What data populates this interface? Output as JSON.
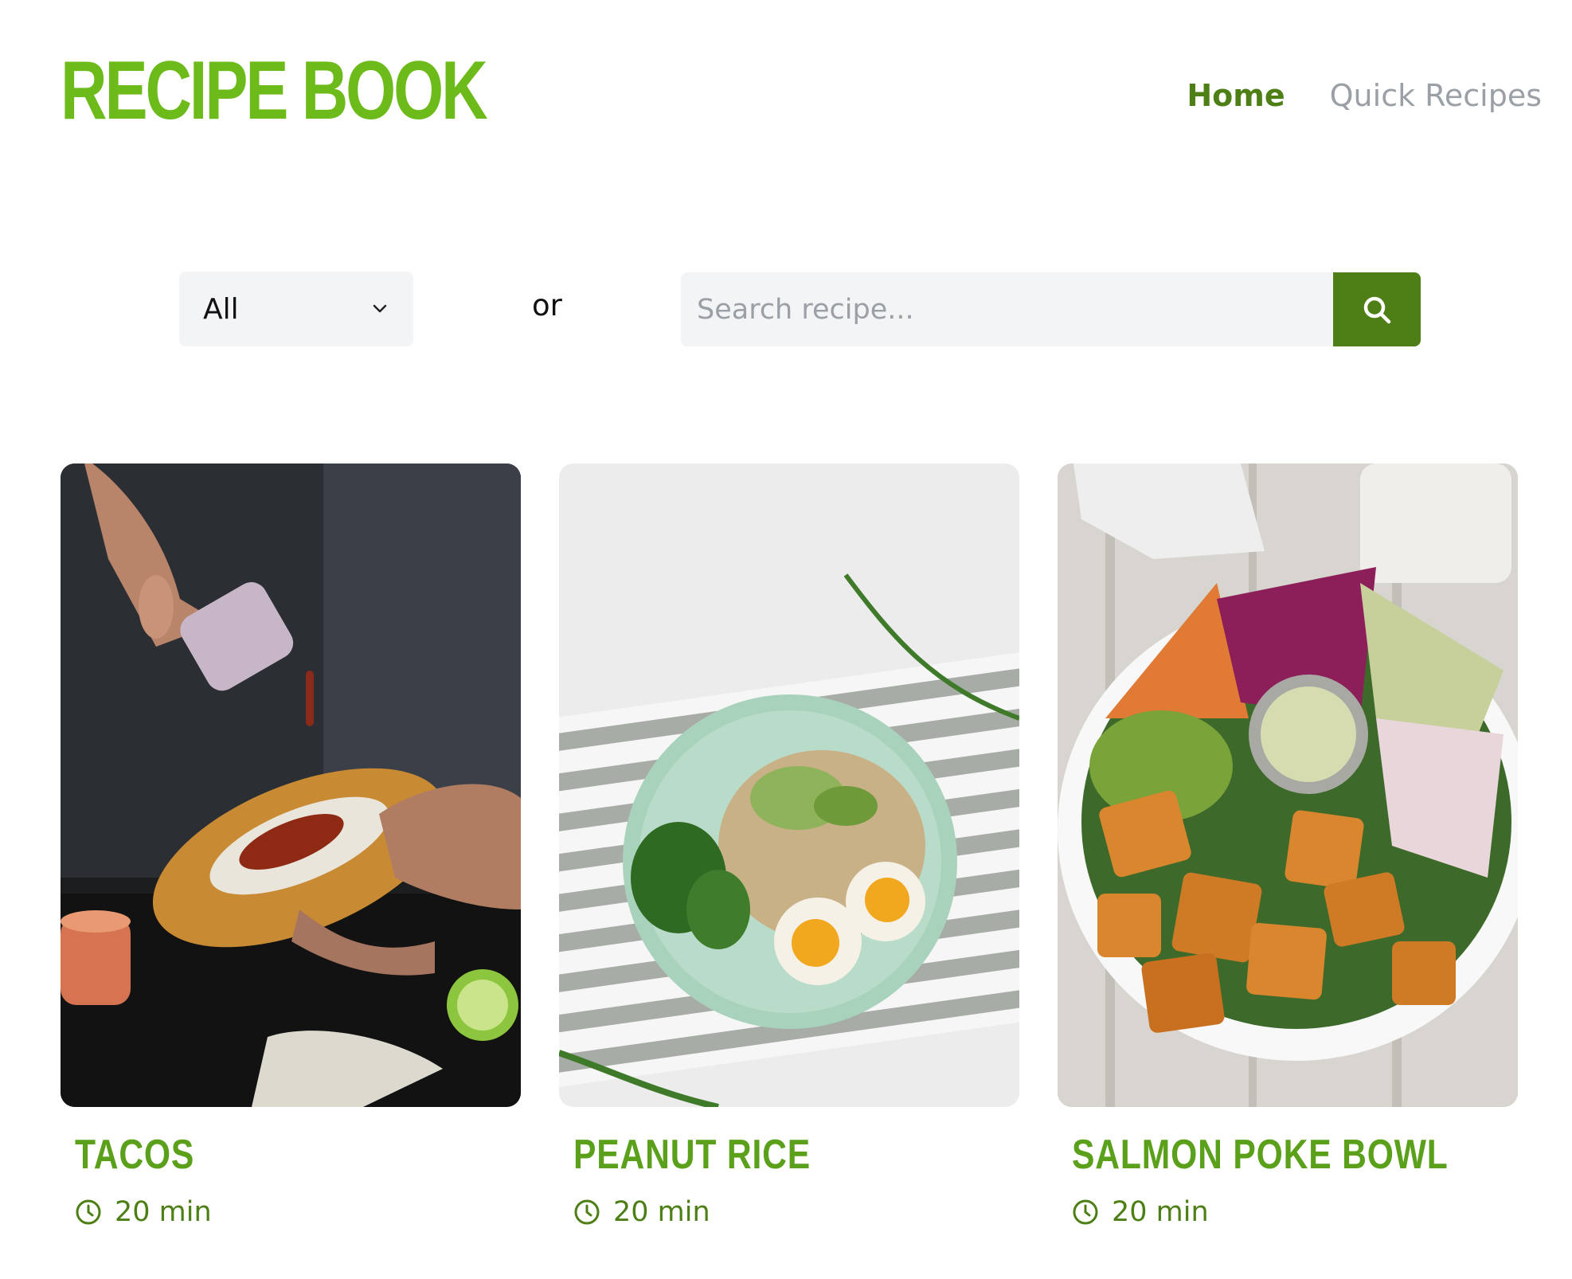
{
  "header": {
    "logo": "RECIPE BOOK",
    "nav": [
      {
        "label": "Home",
        "active": true
      },
      {
        "label": "Quick Recipes",
        "active": false
      }
    ]
  },
  "filters": {
    "category_selected": "All",
    "or_label": "or",
    "search_placeholder": "Search recipe..."
  },
  "recipes": [
    {
      "title": "TACOS",
      "time": "20 min",
      "icon": "clock-icon"
    },
    {
      "title": "PEANUT RICE",
      "time": "20 min",
      "icon": "clock-icon"
    },
    {
      "title": "SALMON POKE BOWL",
      "time": "20 min",
      "icon": "clock-icon"
    }
  ],
  "colors": {
    "brand": "#6cbb1a",
    "accent": "#4d7f16",
    "nav_inactive": "#9aa0a6",
    "input_bg": "#f3f4f6"
  }
}
